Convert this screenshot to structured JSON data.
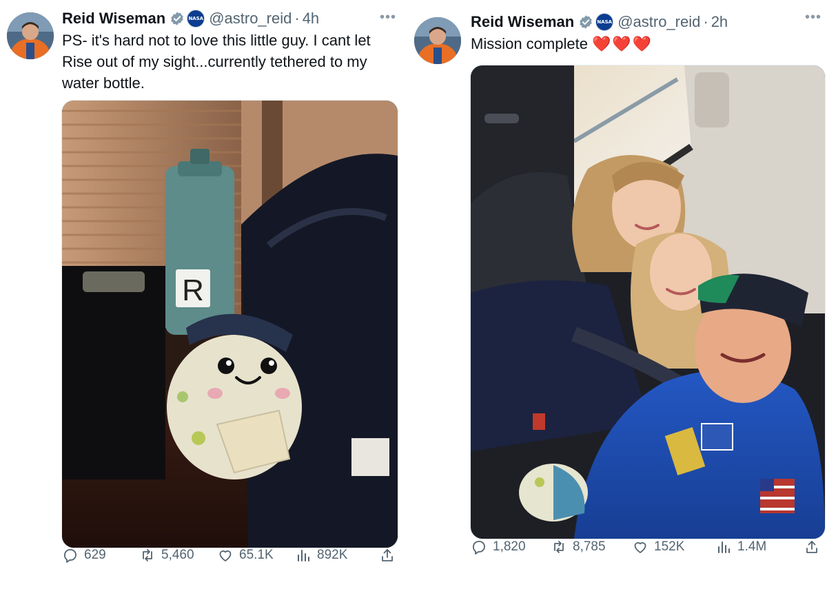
{
  "tweets": [
    {
      "author": {
        "name": "Reid Wiseman",
        "handle": "@astro_reid",
        "badge": "NASA"
      },
      "time": "4h",
      "text": "PS- it's hard not to love this little guy. I cant let Rise out of my sight...currently tethered to my water bottle.",
      "stats": {
        "replies": "629",
        "reposts": "5,460",
        "likes": "65.1K",
        "views": "892K"
      },
      "media_bottle_letter": "R"
    },
    {
      "author": {
        "name": "Reid Wiseman",
        "handle": "@astro_reid",
        "badge": "NASA"
      },
      "time": "2h",
      "text": "Mission complete",
      "emoji": "❤️❤️❤️",
      "stats": {
        "replies": "1,820",
        "reposts": "8,785",
        "likes": "152K",
        "views": "1.4M"
      }
    }
  ],
  "colors": {
    "text": "#0f1419",
    "secondary": "#536471",
    "verified": "#829aab",
    "heart": "#e0245e"
  },
  "icons": [
    "verified-badge-icon",
    "nasa-logo-icon",
    "more-icon",
    "reply-icon",
    "repost-icon",
    "like-icon",
    "views-icon",
    "share-icon"
  ]
}
